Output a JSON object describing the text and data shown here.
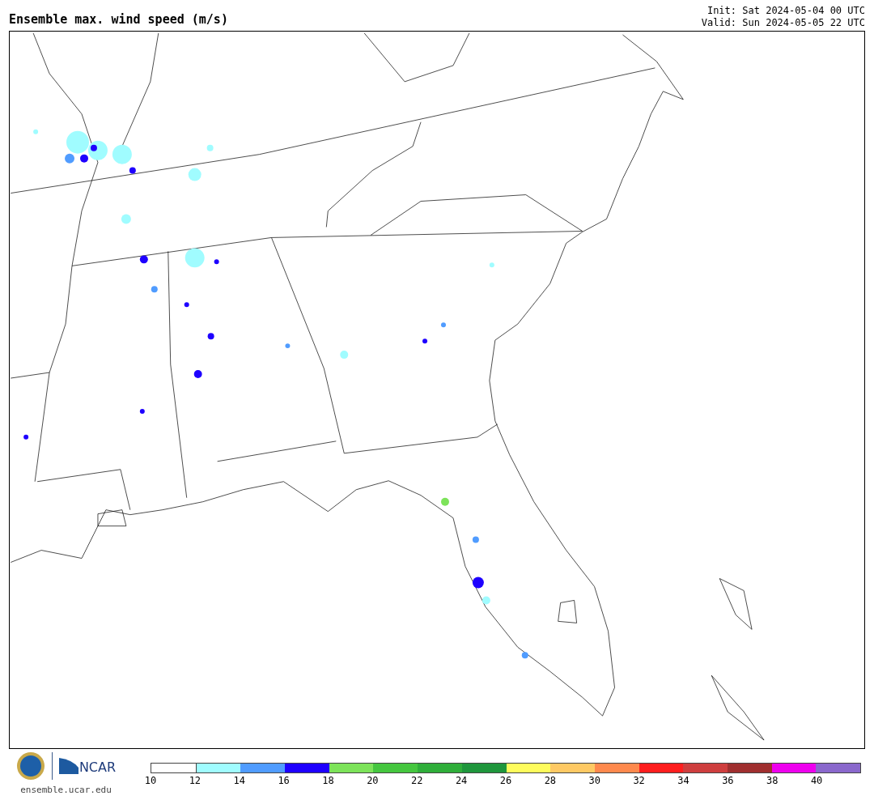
{
  "title": "Ensemble max. wind speed (m/s)",
  "init": "Init: Sat 2024-05-04 00 UTC",
  "valid": "Valid: Sun 2024-05-05 22 UTC",
  "footer": {
    "logo_text": "NCAR",
    "site": "ensemble.ucar.edu"
  },
  "legend": [
    {
      "color": "#ffffff",
      "label": "10"
    },
    {
      "color": "#a0fcff",
      "label": "12"
    },
    {
      "color": "#509cff",
      "label": "14"
    },
    {
      "color": "#1e00ff",
      "label": "16"
    },
    {
      "color": "#7de35a",
      "label": "18"
    },
    {
      "color": "#45c63f",
      "label": "20"
    },
    {
      "color": "#2fae3a",
      "label": "22"
    },
    {
      "color": "#1f963c",
      "label": "24"
    },
    {
      "color": "#fefc5c",
      "label": "26"
    },
    {
      "color": "#fec964",
      "label": "28"
    },
    {
      "color": "#fe894d",
      "label": "30"
    },
    {
      "color": "#fe1e1e",
      "label": "32"
    },
    {
      "color": "#ce3e3e",
      "label": "34"
    },
    {
      "color": "#a02f2f",
      "label": "36"
    },
    {
      "color": "#ee00ee",
      "label": "38"
    },
    {
      "color": "#8a68cc",
      "label": "40"
    }
  ]
}
